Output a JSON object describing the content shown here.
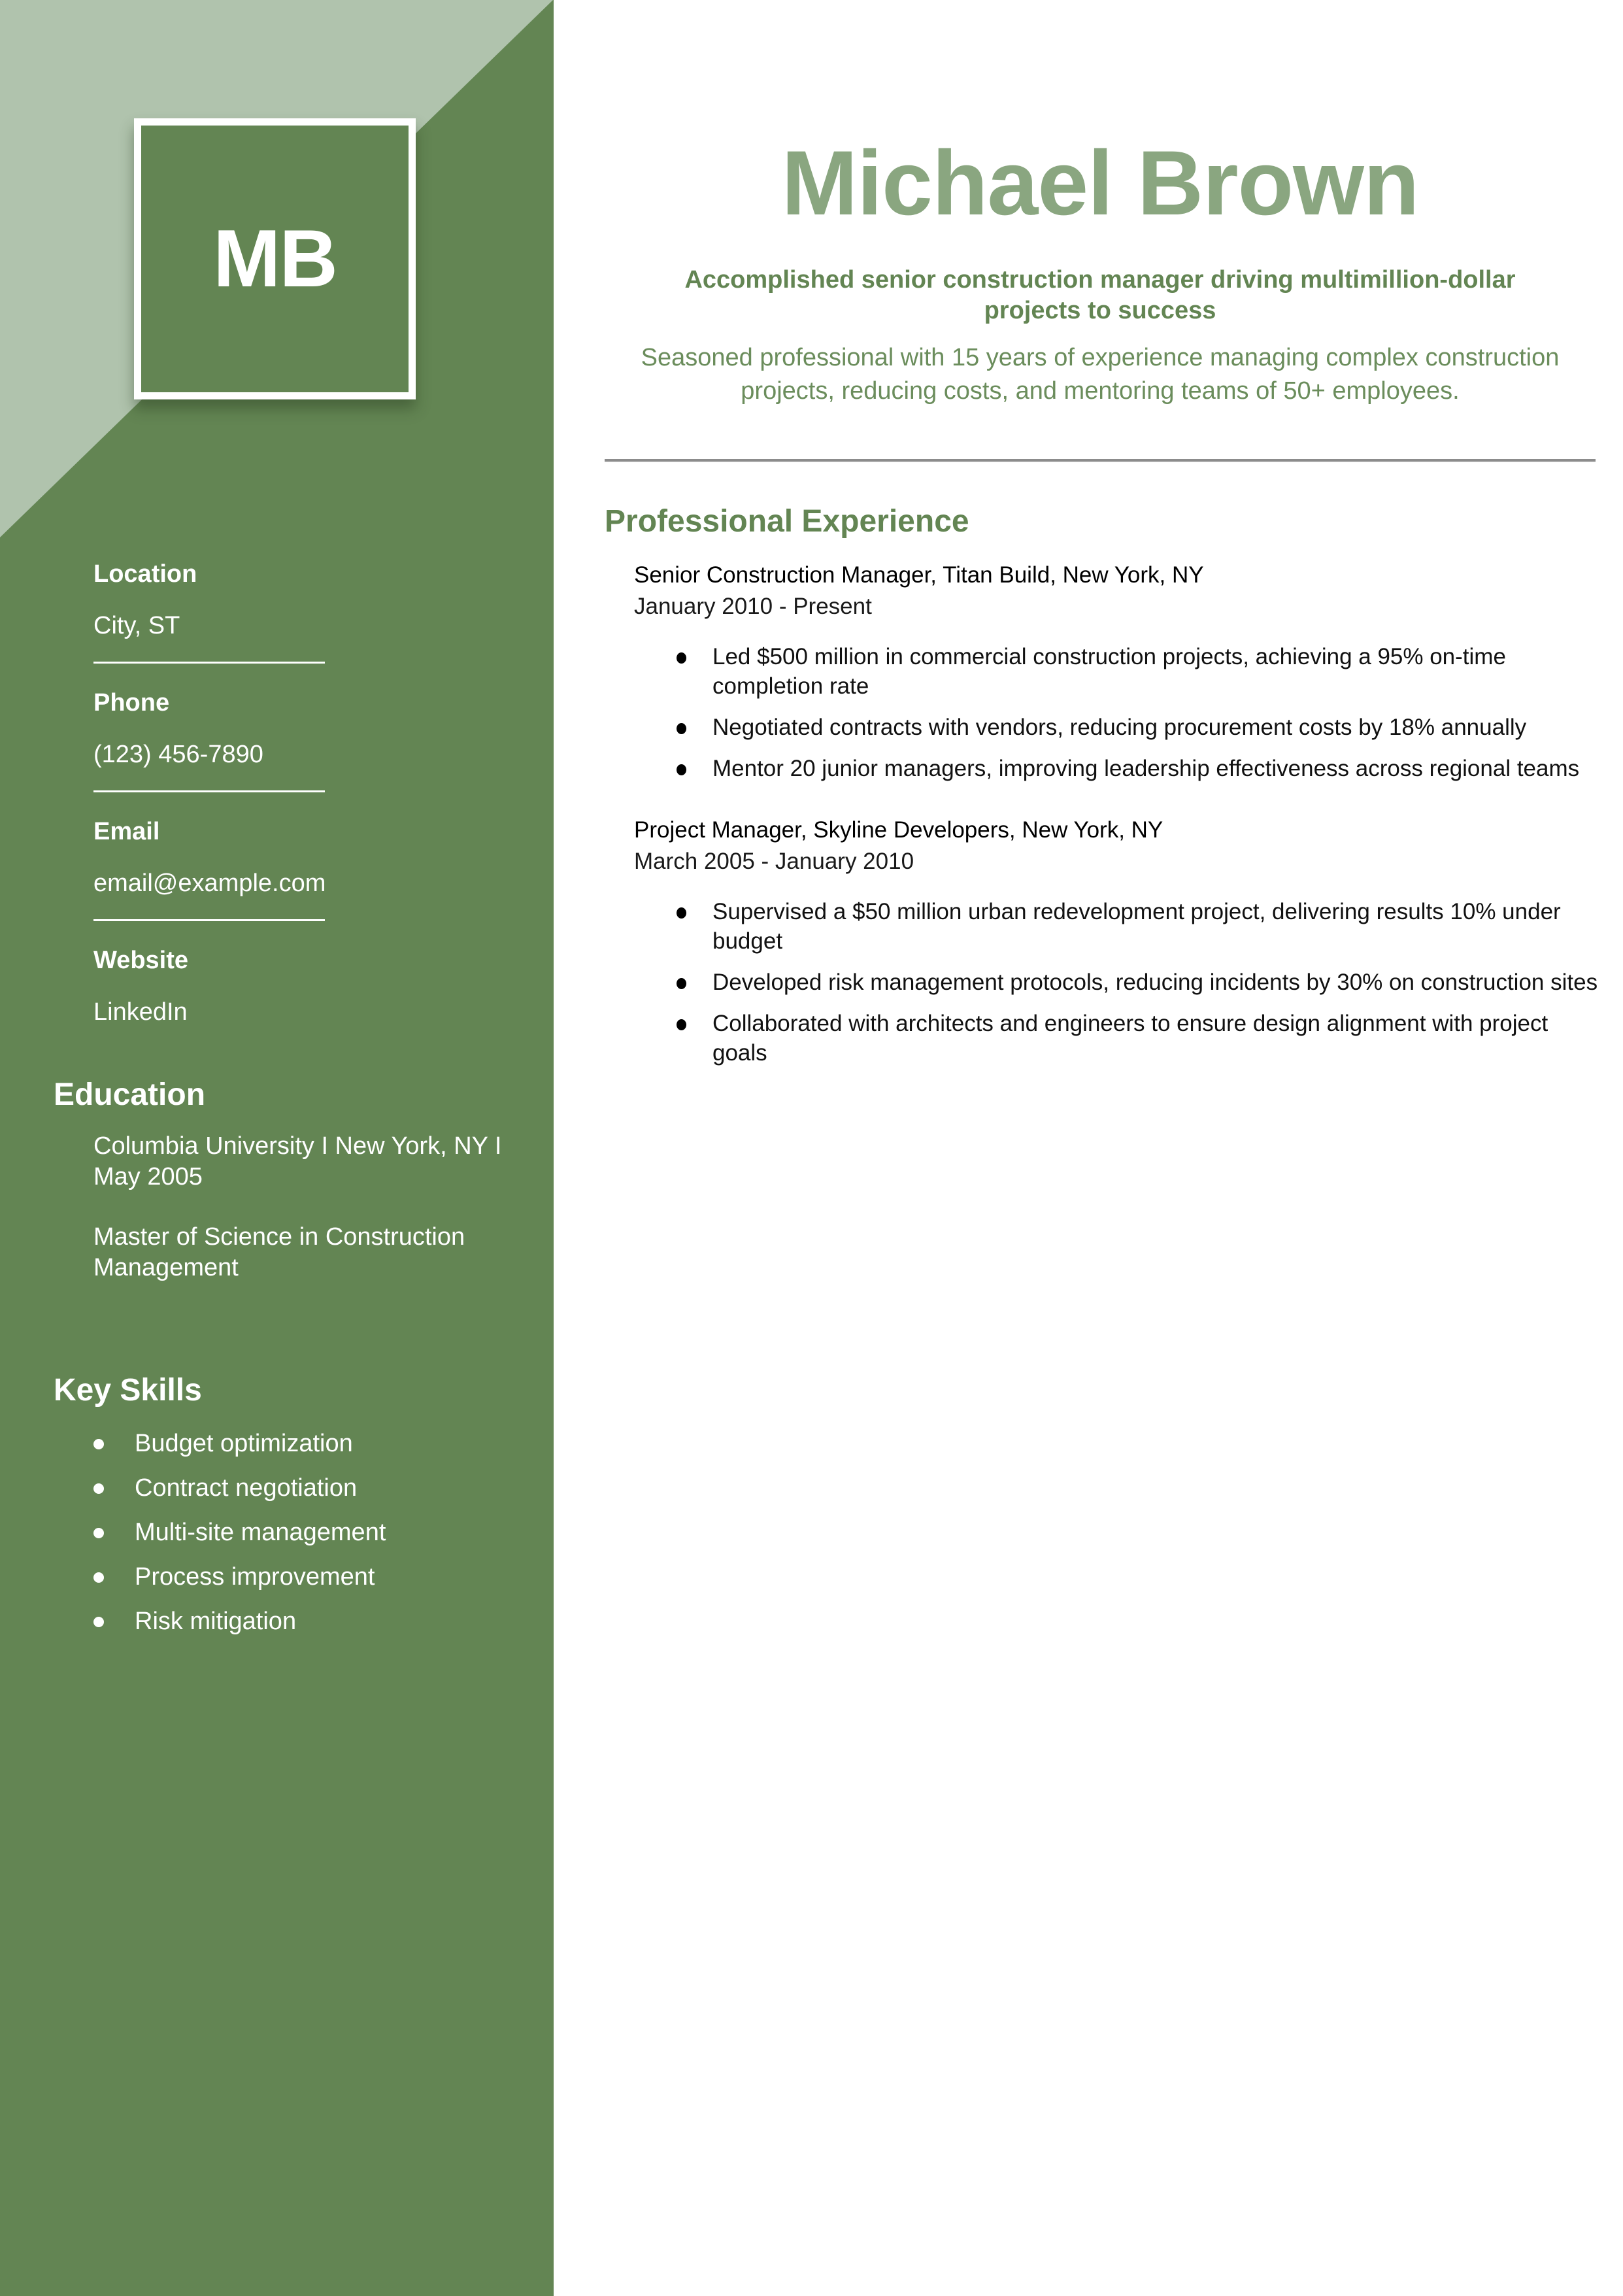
{
  "theme": {
    "sidebar_color": "#638553",
    "sidebar_triangle_color": "#b0c3ad",
    "name_color": "#8aa680",
    "accent_color": "#638553",
    "rule_color": "#8c8c8c"
  },
  "sidebar": {
    "monogram": "MB",
    "contact": [
      {
        "label": "Location",
        "value": "City, ST"
      },
      {
        "label": "Phone",
        "value": "(123) 456-7890"
      },
      {
        "label": "Email",
        "value": "email@example.com"
      },
      {
        "label": "Website",
        "value": "LinkedIn"
      }
    ],
    "education": {
      "heading": "Education",
      "school_line": "Columbia University I New York, NY I May 2005",
      "degree": "Master of Science in Construction Management"
    },
    "skills": {
      "heading": "Key Skills",
      "items": [
        "Budget optimization",
        "Contract negotiation",
        "Multi-site management",
        "Process improvement",
        "Risk mitigation"
      ]
    }
  },
  "header": {
    "name": "Michael Brown",
    "tagline": "Accomplished senior construction manager driving multimillion-dollar projects to success",
    "summary": "Seasoned professional with 15 years of experience managing complex construction projects, reducing costs, and mentoring teams of 50+ employees."
  },
  "experience": {
    "heading": "Professional Experience",
    "jobs": [
      {
        "title": "Senior Construction Manager, Titan Build, New York, NY",
        "dates": "January 2010 - Present",
        "bullets": [
          "Led $500 million in commercial construction projects, achieving a 95% on-time completion rate",
          "Negotiated contracts with vendors, reducing procurement costs by 18% annually",
          "Mentor 20 junior managers, improving leadership effectiveness across regional teams"
        ]
      },
      {
        "title": "Project Manager, Skyline Developers, New York, NY",
        "dates": "March 2005 - January 2010",
        "bullets": [
          "Supervised a $50 million urban redevelopment project, delivering results 10% under budget",
          "Developed risk management protocols, reducing incidents by 30% on construction sites",
          "Collaborated with architects and engineers to ensure design alignment with project goals"
        ]
      }
    ]
  }
}
